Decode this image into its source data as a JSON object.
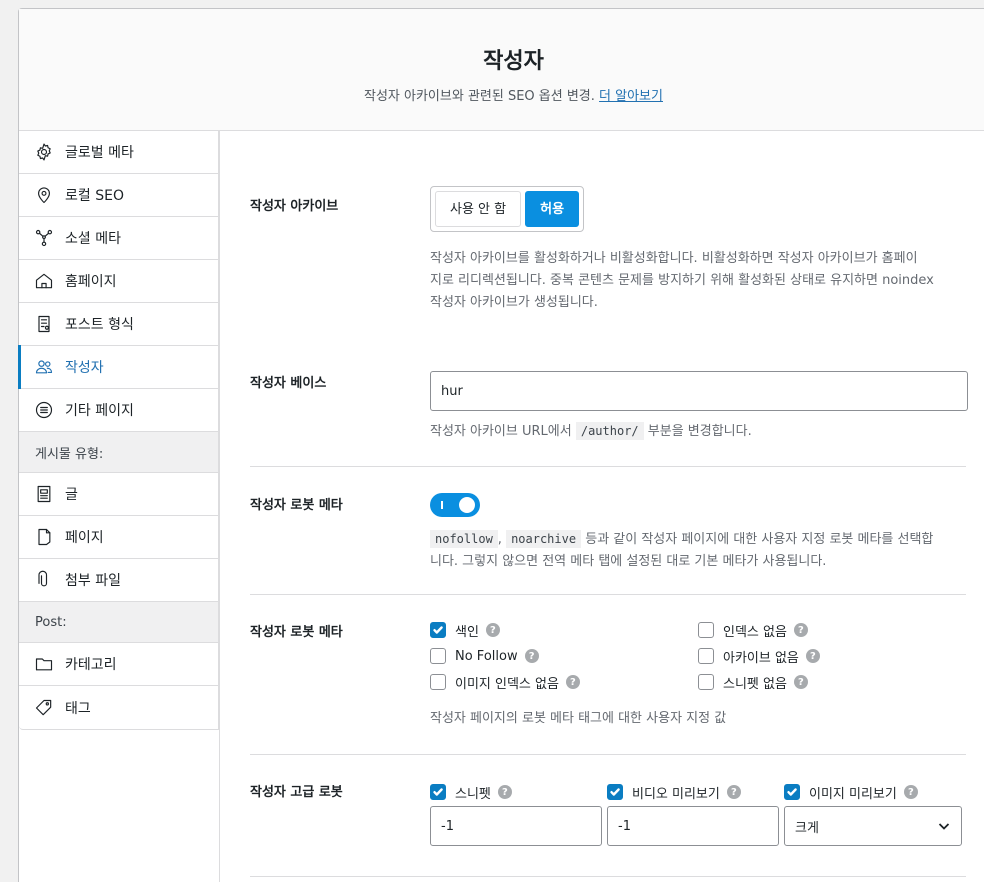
{
  "header": {
    "title": "작성자",
    "description": "작성자 아카이브와 관련된 SEO 옵션 변경.",
    "learn_more": "더 알아보기"
  },
  "sidebar": {
    "items": [
      {
        "label": "글로벌 메타",
        "icon": "gear-icon"
      },
      {
        "label": "로컬 SEO",
        "icon": "location-pin-icon"
      },
      {
        "label": "소셜 메타",
        "icon": "share-nodes-icon"
      },
      {
        "label": "홈페이지",
        "icon": "home-icon"
      },
      {
        "label": "포스트 형식",
        "icon": "post-format-icon"
      },
      {
        "label": "작성자",
        "icon": "users-icon",
        "active": true
      },
      {
        "label": "기타 페이지",
        "icon": "list-circle-icon"
      }
    ],
    "group_post_types": "게시물 유형:",
    "post_type_items": [
      {
        "label": "글",
        "icon": "post-icon"
      },
      {
        "label": "페이지",
        "icon": "page-icon"
      },
      {
        "label": "첨부 파일",
        "icon": "paperclip-icon"
      }
    ],
    "group_post": "Post:",
    "taxonomy_items": [
      {
        "label": "카테고리",
        "icon": "folder-icon"
      },
      {
        "label": "태그",
        "icon": "tag-icon"
      }
    ]
  },
  "archive": {
    "label": "작성자 아카이브",
    "off": "사용 안 함",
    "on": "허용",
    "help": [
      "작성자 아카이브를 활성화하거나 비활성화합니다. 비활성화하면 작성자 아카이브가 홈페이",
      "지로 리디렉션됩니다. 중복 콘텐츠 문제를 방지하기 위해 활성화된 상태로 유지하면 noindex",
      "작성자 아카이브가 생성됩니다."
    ]
  },
  "base": {
    "label": "작성자 베이스",
    "value": "hur",
    "help_before": "작성자 아카이브 URL에서",
    "help_code": "/author/",
    "help_after": "부분을 변경합니다."
  },
  "robots_toggle": {
    "label": "작성자 로봇 메타",
    "code1": "nofollow",
    "code2": "noarchive",
    "help_line1": "등과 같이 작성자 페이지에 대한 사용자 지정 로봇 메타를 선택합",
    "help_line2": "니다. 그렇지 않으면 전역 메타 탭에 설정된 대로 기본 메타가 사용됩니다."
  },
  "robots_meta": {
    "label": "작성자 로봇 메타",
    "options": [
      {
        "label": "색인",
        "checked": true
      },
      {
        "label": "인덱스 없음",
        "checked": false
      },
      {
        "label": "No Follow",
        "checked": false
      },
      {
        "label": "아카이브 없음",
        "checked": false
      },
      {
        "label": "이미지 인덱스 없음",
        "checked": false
      },
      {
        "label": "스니펫 없음",
        "checked": false
      }
    ],
    "help": "작성자 페이지의 로봇 메타 태그에 대한 사용자 지정 값"
  },
  "advanced": {
    "label": "작성자 고급 로봇",
    "snippet": "스니펫",
    "video": "비디오 미리보기",
    "image": "이미지 미리보기",
    "snippet_value": "-1",
    "video_value": "-1",
    "image_value": "크게"
  }
}
